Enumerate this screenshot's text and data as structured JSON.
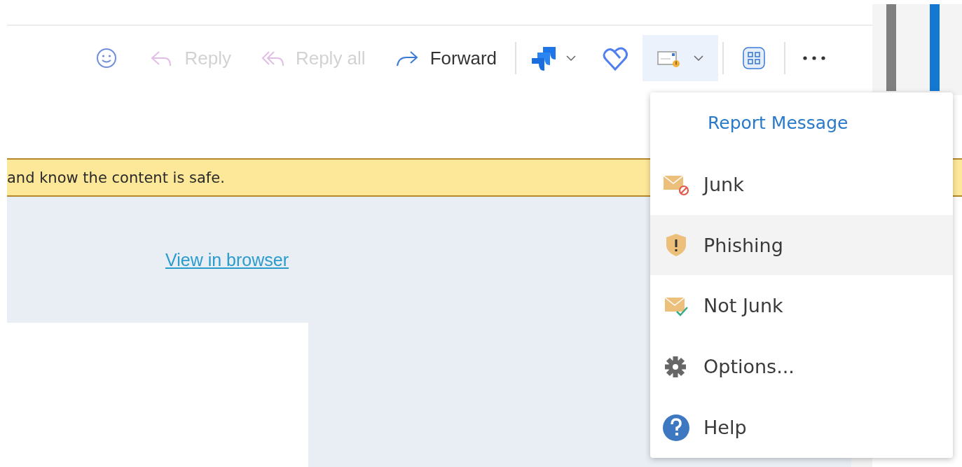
{
  "toolbar": {
    "actions": [
      {
        "label": "Reply",
        "disabled": true
      },
      {
        "label": "Reply all",
        "disabled": true
      },
      {
        "label": "Forward",
        "disabled": false
      }
    ],
    "report_button": {
      "pressed": true
    }
  },
  "banner": {
    "text": "and know the content is safe."
  },
  "message": {
    "link": "View in browser"
  },
  "report_menu": {
    "header": "Report Message",
    "items": [
      {
        "label": "Junk",
        "selected": false
      },
      {
        "label": "Phishing",
        "selected": true
      },
      {
        "label": "Not Junk",
        "selected": false
      },
      {
        "label": "Options...",
        "selected": false
      },
      {
        "label": "Help",
        "selected": false
      }
    ]
  }
}
